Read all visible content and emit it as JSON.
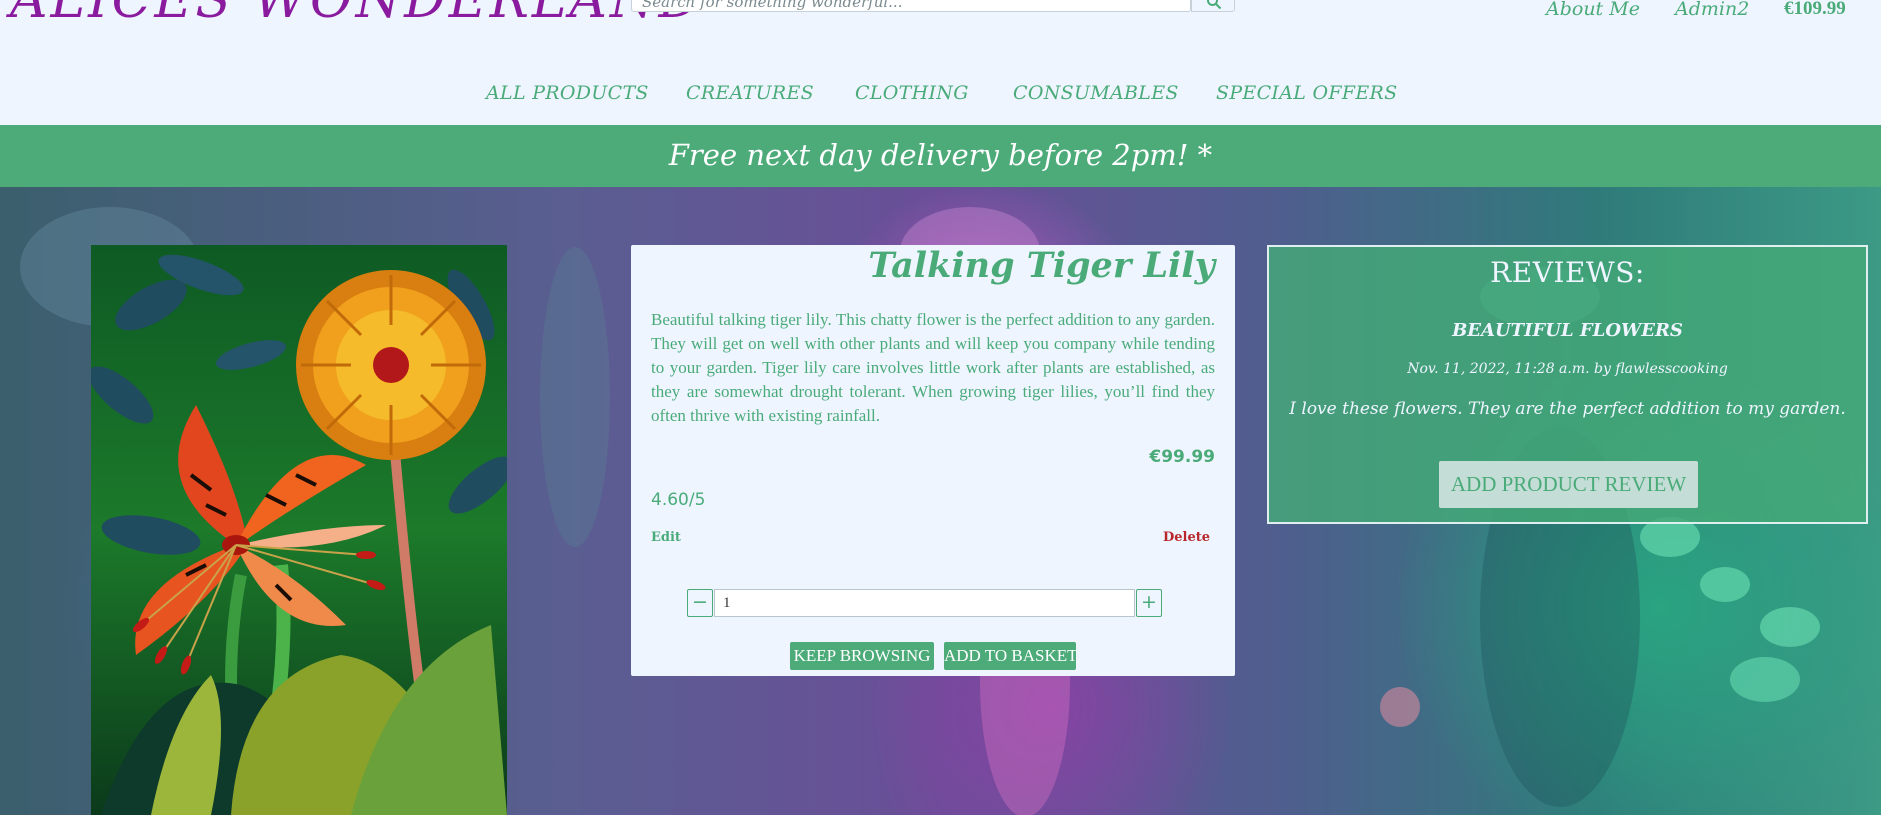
{
  "header": {
    "logo": "ALICES WONDERLAND",
    "search_placeholder": "Search for something wonderful...",
    "search_icon": "search-icon",
    "links": {
      "about": "About Me",
      "account": "Admin2",
      "basket_total": "€109.99"
    }
  },
  "nav": {
    "items": [
      {
        "label": "ALL PRODUCTS"
      },
      {
        "label": "CREATURES"
      },
      {
        "label": "CLOTHING"
      },
      {
        "label": "CONSUMABLES"
      },
      {
        "label": "SPECIAL OFFERS"
      }
    ]
  },
  "banner": {
    "text": "Free next day delivery before 2pm! *"
  },
  "product": {
    "title": "Talking Tiger Lily",
    "description": "Beautiful talking tiger lily. This chatty flower is the perfect addition to any garden. They will get on well with other plants and will keep you company while tending to your garden. Tiger lily care involves little work after plants are established, as they are somewhat drought tolerant. When growing tiger lilies, you’ll find they often thrive with existing rainfall.",
    "price": "€99.99",
    "rating": "4.60/5",
    "edit_label": "Edit",
    "delete_label": "Delete",
    "quantity": "1",
    "minus_label": "−",
    "plus_label": "+",
    "keep_browsing_label": "KEEP BROWSING",
    "add_to_basket_label": "ADD TO BASKET"
  },
  "reviews": {
    "heading": "REVIEWS:",
    "items": [
      {
        "title": "BEAUTIFUL FLOWERS",
        "meta": "Nov. 11, 2022, 11:28 a.m. by flawlesscooking",
        "body": "I love these flowers. They are the perfect addition to my garden."
      }
    ],
    "add_review_label": "ADD PRODUCT REVIEW"
  },
  "colors": {
    "accent_green": "#4aab79",
    "banner_green": "#4dab7a",
    "logo_purple": "#8a1b9e",
    "delete_red": "#b8282b",
    "page_bg": "#eef5ff"
  }
}
